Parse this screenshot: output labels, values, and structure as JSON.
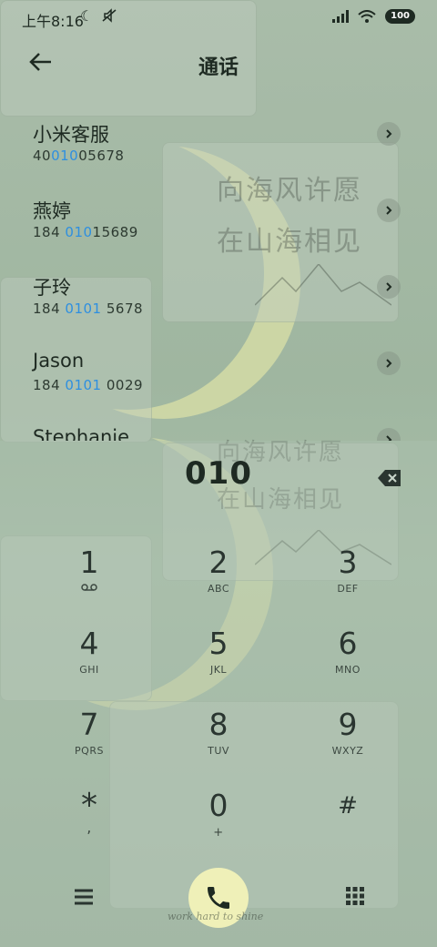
{
  "status_bar": {
    "time": "上午8:16",
    "battery": "100"
  },
  "header": {
    "title": "通话"
  },
  "contacts": [
    {
      "name": "小米客服",
      "num_pre": "40",
      "num_hl": "010",
      "num_post": "05678"
    },
    {
      "name": "燕婷",
      "num_pre": "184 ",
      "num_hl": "010",
      "num_post": "15689"
    },
    {
      "name": "子玲",
      "num_pre": "184 ",
      "num_hl": "0101",
      "num_post": " 5678"
    },
    {
      "name": "Jason",
      "num_pre": "184 ",
      "num_hl": "0101",
      "num_post": " 0029"
    },
    {
      "name": "Stephanie",
      "num_pre": "",
      "num_hl": "",
      "num_post": ""
    }
  ],
  "dialer": {
    "input": "010",
    "keys": [
      {
        "digit": "1",
        "letters": ""
      },
      {
        "digit": "2",
        "letters": "ABC"
      },
      {
        "digit": "3",
        "letters": "DEF"
      },
      {
        "digit": "4",
        "letters": "GHI"
      },
      {
        "digit": "5",
        "letters": "JKL"
      },
      {
        "digit": "6",
        "letters": "MNO"
      },
      {
        "digit": "7",
        "letters": "PQRS"
      },
      {
        "digit": "8",
        "letters": "TUV"
      },
      {
        "digit": "9",
        "letters": "WXYZ"
      },
      {
        "digit": "*",
        "letters": ","
      },
      {
        "digit": "0",
        "letters": "+"
      },
      {
        "digit": "#",
        "letters": ""
      }
    ]
  },
  "wallpaper": {
    "poem_line1": "向海风许愿",
    "poem_line2": "在山海相见",
    "signature": "work  hard  to  shine"
  },
  "colors": {
    "highlight": "#2e8fe0",
    "call_button": "#eff0b8",
    "text": "#1e2a22"
  }
}
